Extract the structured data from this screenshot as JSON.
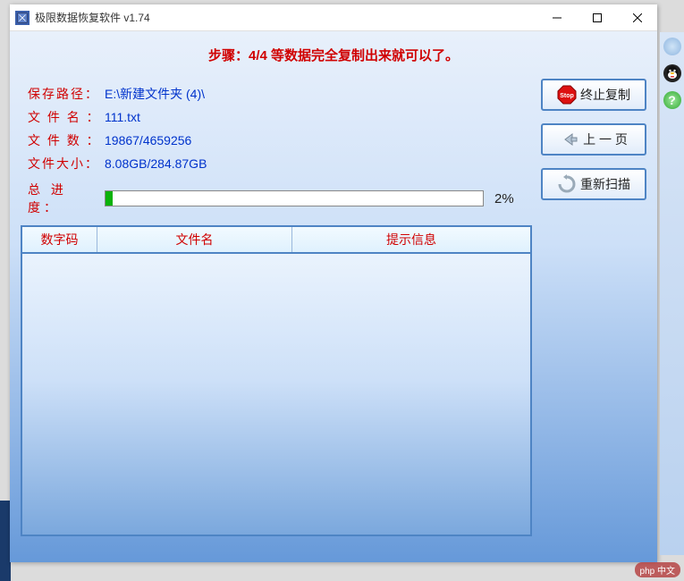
{
  "window": {
    "title": "极限数据恢复软件 v1.74"
  },
  "step": {
    "title": "步骤：4/4 等数据完全复制出来就可以了。"
  },
  "info": {
    "save_path_label": "保存路径：",
    "save_path_value": "E:\\新建文件夹 (4)\\",
    "filename_label": "文 件 名 ：",
    "filename_value": "111.txt",
    "filecount_label": "文 件 数 ：",
    "filecount_value": "19867/4659256",
    "filesize_label": "文件大小：",
    "filesize_value": "8.08GB/284.87GB",
    "progress_label": "总 进 度：",
    "progress_percent": 2,
    "progress_text": "2%"
  },
  "table": {
    "col1": "数字码",
    "col2": "文件名",
    "col3": "提示信息"
  },
  "buttons": {
    "stop": "终止复制",
    "prev": "上 一 页",
    "rescan": "重新扫描"
  },
  "watermark": "php 中文"
}
